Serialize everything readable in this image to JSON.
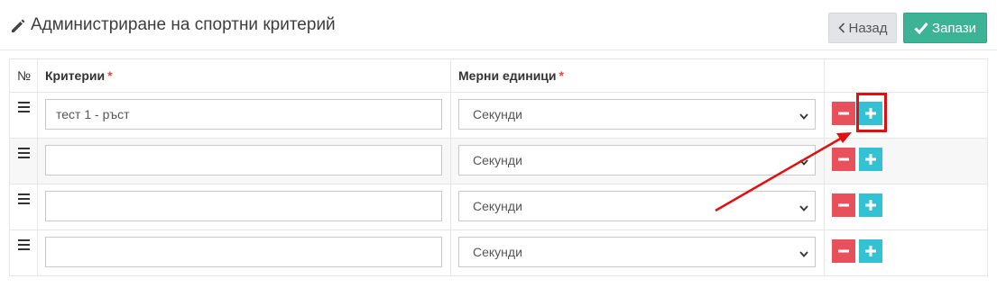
{
  "header": {
    "title": "Администриране на спортни критерий",
    "back_label": "Назад",
    "save_label": "Запази"
  },
  "table": {
    "columns": [
      "№",
      "Критерии",
      "Мерни единици"
    ],
    "required_mark": "*",
    "rows": [
      {
        "criterion": "тест 1 - ръст",
        "unit": "Секунди",
        "placeholder": ""
      },
      {
        "criterion": "",
        "unit": "Секунди",
        "placeholder": ""
      },
      {
        "criterion": "",
        "unit": "Секунди",
        "placeholder": ""
      },
      {
        "criterion": "",
        "unit": "Секунди",
        "placeholder": ""
      }
    ]
  },
  "colors": {
    "save": "#3cb394",
    "remove": "#e8505b",
    "add": "#33c2d3",
    "annotation": "#e01010"
  }
}
